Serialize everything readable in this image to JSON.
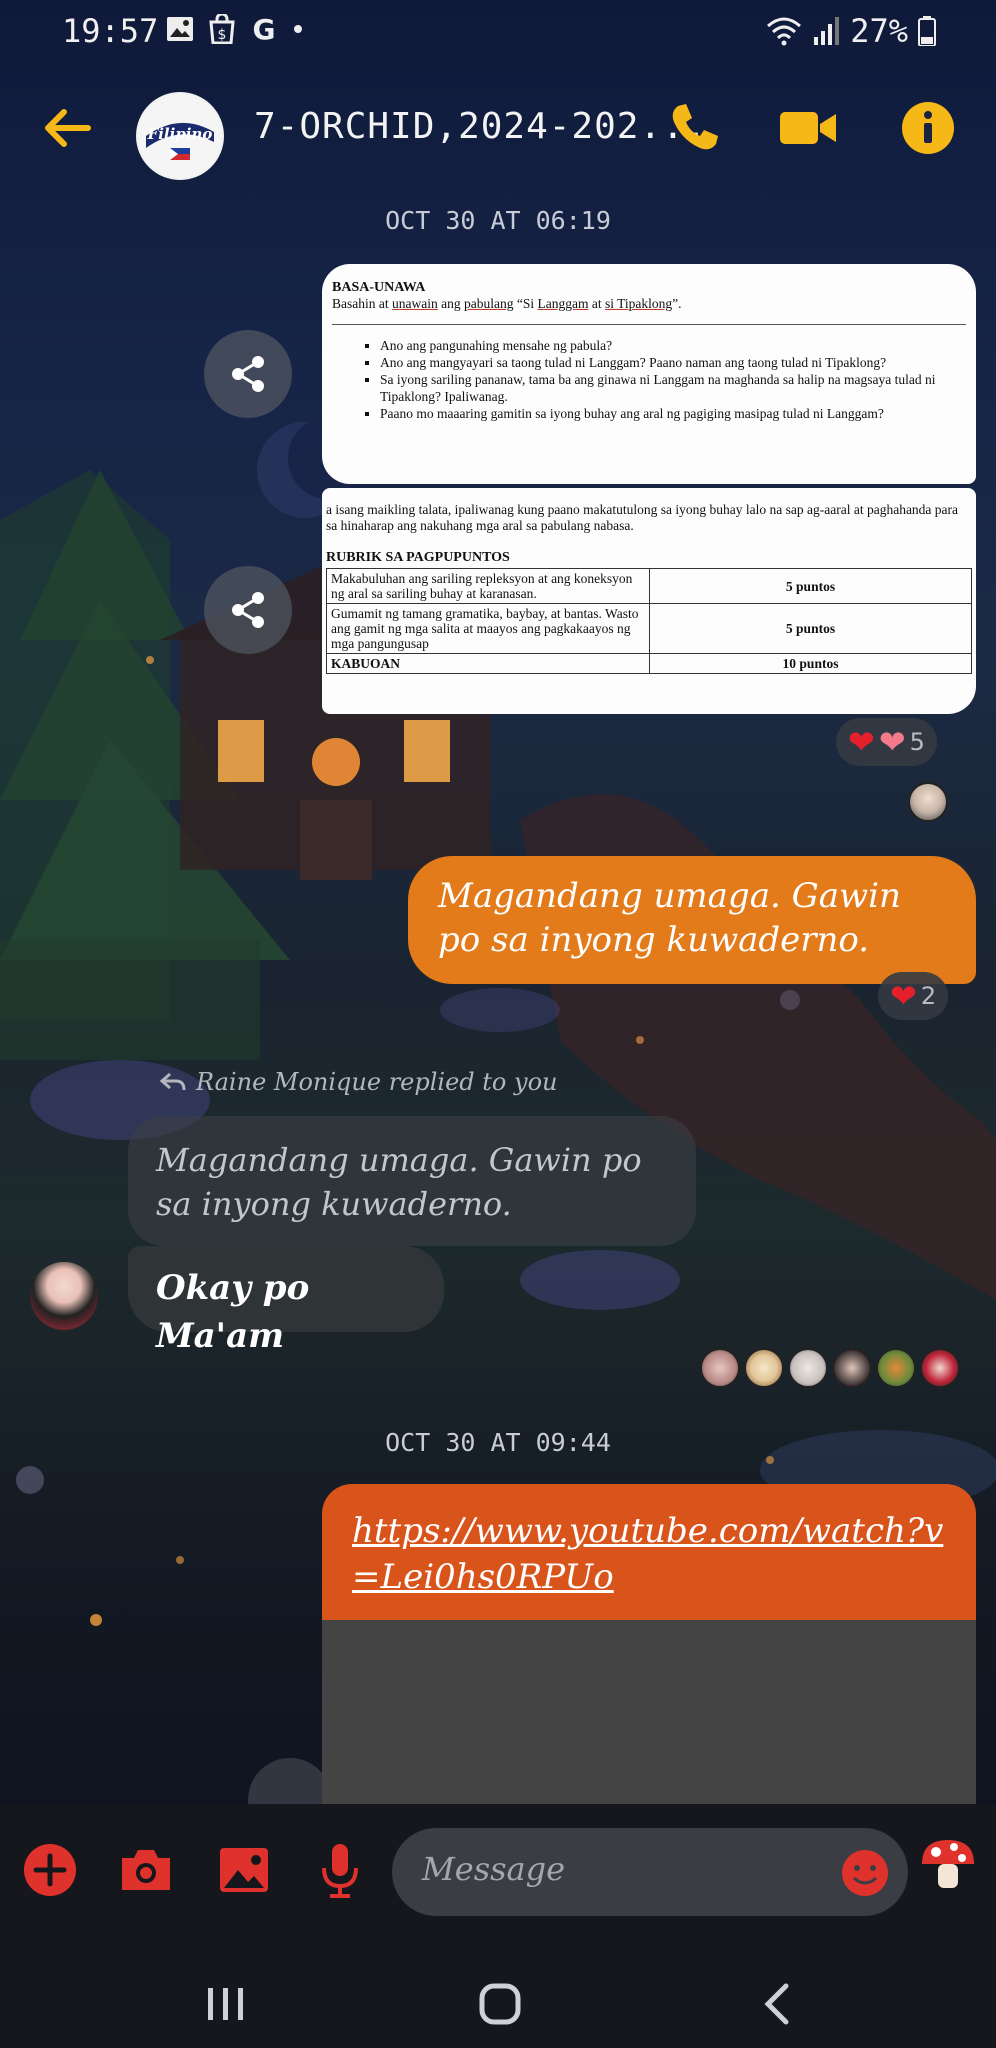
{
  "status_bar": {
    "time": "19:57",
    "battery": "27%"
  },
  "header": {
    "title": "7-ORCHID,2024-202...",
    "avatar_text": "Filipino",
    "icons": [
      "back-arrow-icon",
      "phone-icon",
      "video-camera-icon",
      "info-icon"
    ],
    "accent_color": "#f6b817"
  },
  "messages": {
    "date1": "OCT 30 AT 06:19",
    "doc1": {
      "title": "BASA-UNAWA",
      "intro_a": "Basahin at ",
      "intro_b": "unawain",
      "intro_c": " ang ",
      "intro_d": "pabulang",
      "intro_e": " “Si ",
      "intro_f": "Langgam",
      "intro_g": " at ",
      "intro_h": "si Tipaklong",
      "intro_i": "”.",
      "bullets": [
        "Ano ang pangunahing mensahe ng pabula?",
        "Ano ang mangyayari sa taong tulad ni Langgam? Paano naman ang taong tulad ni Tipaklong?",
        "Sa iyong sariling pananaw, tama ba ang ginawa ni Langgam na maghanda sa halip na magsaya tulad ni Tipaklong? Ipaliwanag.",
        "Paano mo maaaring gamitin sa iyong buhay ang aral ng pagiging masipag tulad ni Langgam?"
      ]
    },
    "doc2": {
      "para": "a isang maikling talata, ipaliwanag kung paano makatutulong sa iyong buhay lalo na sap ag-aaral at paghahanda para sa hinaharap ang nakuhang mga aral sa pabulang nabasa.",
      "rubric_title": "RUBRIK SA PAGPUPUNTOS",
      "rows": [
        {
          "criteria": "Makabuluhan ang sariling repleksyon at ang koneksyon ng aral sa sariling buhay at karanasan.",
          "points": "5 puntos"
        },
        {
          "criteria": "Gumamit ng tamang gramatika, baybay, at bantas. Wasto ang gamit ng mga salita at maayos ang pagkakaayos ng mga pangungusap",
          "points": "5 puntos"
        },
        {
          "criteria": "KABUOAN",
          "points": "10 puntos"
        }
      ]
    },
    "doc_reaction_count": "5",
    "teacher_msg": "Magandang umaga. Gawin po sa inyong kuwaderno.",
    "teacher_reaction_count": "2",
    "reply_label": "Raine Monique replied to you",
    "quoted_text": "Magandang umaga. Gawin po sa inyong kuwaderno.",
    "reply_text": "Okay po Ma'am",
    "date2": "OCT 30 AT 09:44",
    "link_url": "https://www.youtube.com/watch?v=Lei0hs0RPUo"
  },
  "composer": {
    "placeholder": "Message",
    "tools": [
      "add-icon",
      "camera-icon",
      "gallery-icon",
      "microphone-icon",
      "emoji-icon",
      "mushroom-icon"
    ],
    "tool_color": "#e0322d"
  },
  "navigation": [
    "recent-apps-icon",
    "home-icon",
    "back-icon"
  ]
}
